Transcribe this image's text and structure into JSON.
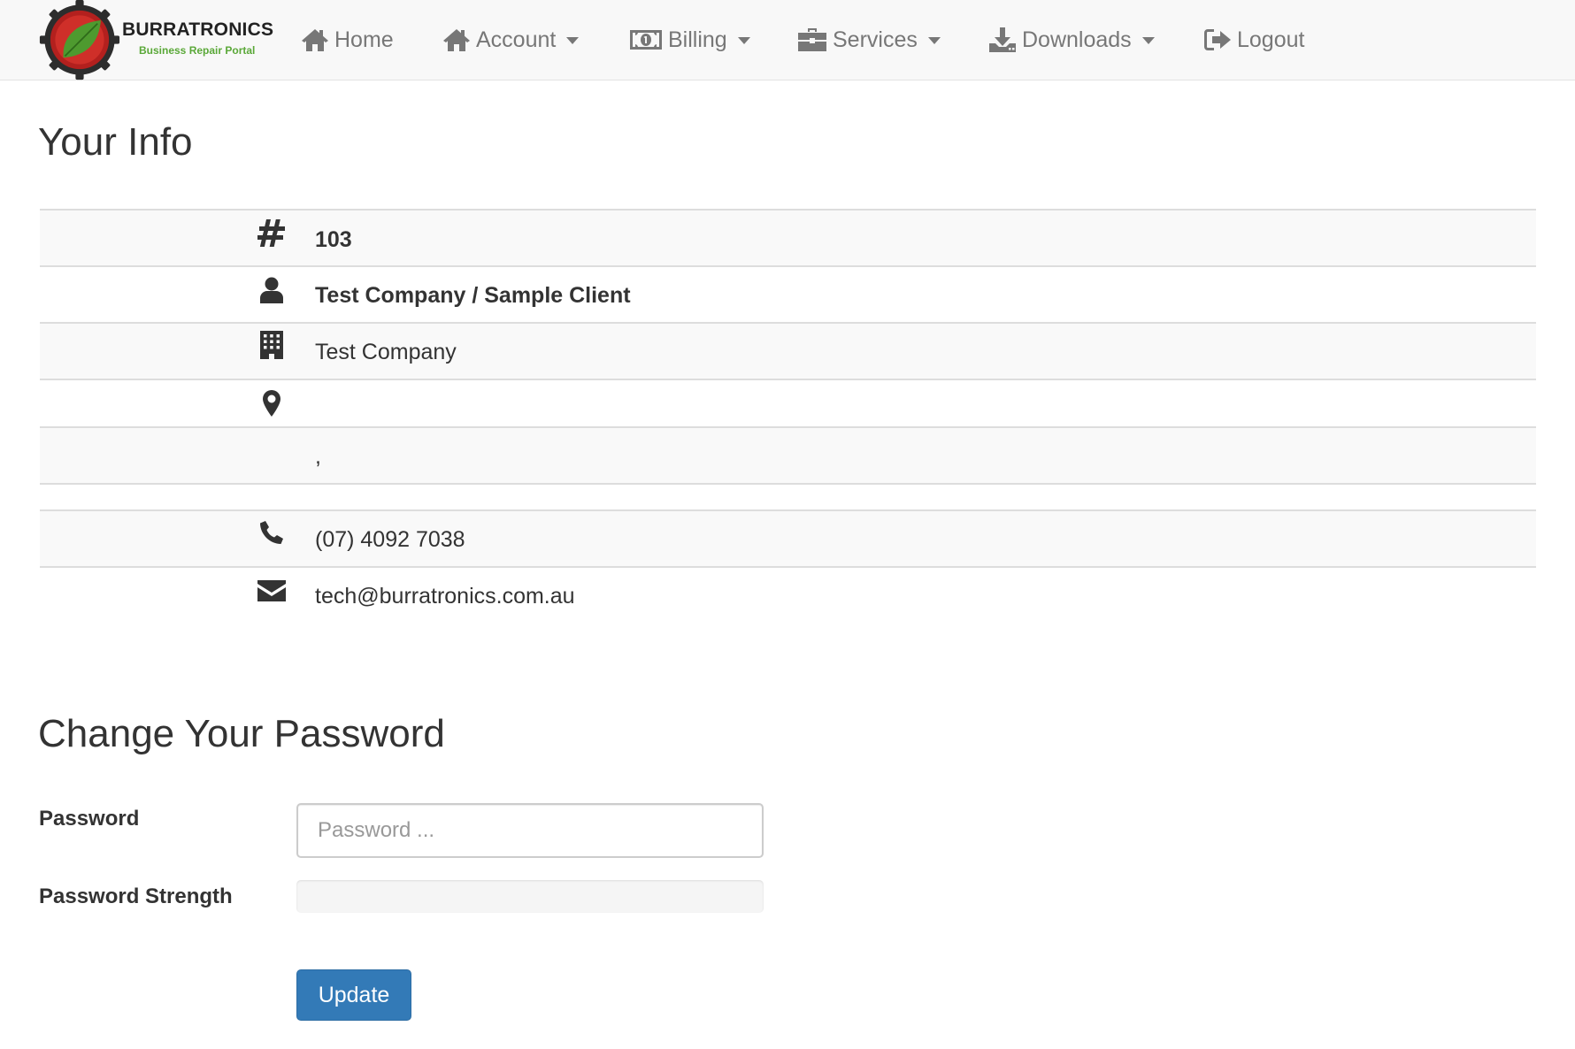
{
  "brand": {
    "name": "BURRATRONICS",
    "tagline": "Business Repair Portal"
  },
  "nav": {
    "home": "Home",
    "account": "Account",
    "billing": "Billing",
    "services": "Services",
    "downloads": "Downloads",
    "logout": "Logout"
  },
  "info": {
    "title": "Your Info",
    "client_number": "103",
    "client_name": "Test Company / Sample Client",
    "company": "Test Company",
    "address_line1": "",
    "address_line2": ",",
    "phone": "(07) 4092 7038",
    "email": "tech@burratronics.com.au"
  },
  "password_form": {
    "title": "Change Your Password",
    "password_label": "Password",
    "password_placeholder": "Password ...",
    "password_value": "",
    "strength_label": "Password Strength",
    "strength_level": 0,
    "update_label": "Update"
  },
  "colors": {
    "navbar_bg": "#f8f8f8",
    "nav_text": "#777777",
    "row_stripe": "#f9f9f9",
    "primary_button": "#337ab7",
    "brand_tag": "#5aa838"
  }
}
